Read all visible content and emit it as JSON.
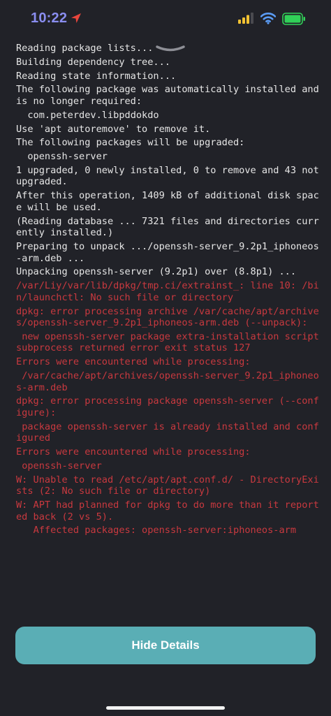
{
  "status": {
    "time": "10:22",
    "icons": [
      "location-arrow-icon",
      "signal-bars-icon",
      "wifi-icon",
      "battery-icon"
    ],
    "colors": {
      "time": "#8a8ef0",
      "signal": "#f2c233",
      "wifi": "#5b9cf5",
      "battery": "#31d158"
    }
  },
  "console": {
    "lines": [
      {
        "text": "Reading package lists...",
        "type": "normal"
      },
      {
        "text": "Building dependency tree...",
        "type": "normal"
      },
      {
        "text": "Reading state information...",
        "type": "normal"
      },
      {
        "text": "The following package was automatically installed and is no longer required:",
        "type": "normal"
      },
      {
        "text": "  com.peterdev.libpddokdo",
        "type": "normal"
      },
      {
        "text": "Use 'apt autoremove' to remove it.",
        "type": "normal"
      },
      {
        "text": "The following packages will be upgraded:",
        "type": "normal"
      },
      {
        "text": "  openssh-server",
        "type": "normal"
      },
      {
        "text": "1 upgraded, 0 newly installed, 0 to remove and 43 not upgraded.",
        "type": "normal"
      },
      {
        "text": "After this operation, 1409 kB of additional disk space will be used.",
        "type": "normal"
      },
      {
        "text": "(Reading database ... 7321 files and directories currently installed.)",
        "type": "normal"
      },
      {
        "text": "Preparing to unpack .../openssh-server_9.2p1_iphoneos-arm.deb ...",
        "type": "normal"
      },
      {
        "text": "Unpacking openssh-server (9.2p1) over (8.8p1) ...",
        "type": "normal"
      },
      {
        "text": "/var/Liy/var/lib/dpkg/tmp.ci/extrainst_: line 10: /bin/launchctl: No such file or directory",
        "type": "error"
      },
      {
        "text": "dpkg: error processing archive /var/cache/apt/archives/openssh-server_9.2p1_iphoneos-arm.deb (--unpack):",
        "type": "error"
      },
      {
        "text": " new openssh-server package extra-installation script subprocess returned error exit status 127",
        "type": "error"
      },
      {
        "text": "Errors were encountered while processing:",
        "type": "error"
      },
      {
        "text": " /var/cache/apt/archives/openssh-server_9.2p1_iphoneos-arm.deb",
        "type": "error"
      },
      {
        "text": "dpkg: error processing package openssh-server (--configure):",
        "type": "error"
      },
      {
        "text": " package openssh-server is already installed and configured",
        "type": "error"
      },
      {
        "text": "Errors were encountered while processing:",
        "type": "error"
      },
      {
        "text": " openssh-server",
        "type": "error"
      },
      {
        "text": "W: Unable to read /etc/apt/apt.conf.d/ - DirectoryExists (2: No such file or directory)",
        "type": "error"
      },
      {
        "text": "W: APT had planned for dpkg to do more than it reported back (2 vs 5).",
        "type": "error"
      },
      {
        "text": "   Affected packages: openssh-server:iphoneos-arm",
        "type": "error"
      }
    ],
    "colors": {
      "normal": "#e6e6e6",
      "error": "#c9393f"
    }
  },
  "button": {
    "label": "Hide Details",
    "color": "#5aaeb5"
  }
}
